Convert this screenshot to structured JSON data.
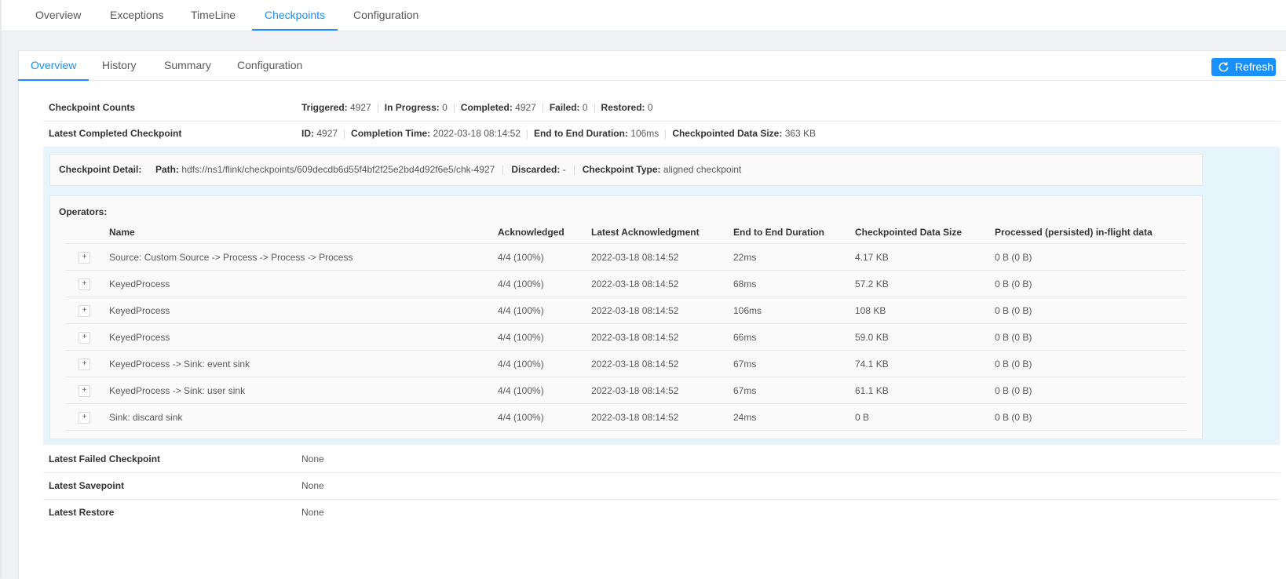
{
  "top_tabs": [
    {
      "label": "Overview"
    },
    {
      "label": "Exceptions"
    },
    {
      "label": "TimeLine"
    },
    {
      "label": "Checkpoints"
    },
    {
      "label": "Configuration"
    }
  ],
  "sub_tabs": [
    {
      "label": "Overview"
    },
    {
      "label": "History"
    },
    {
      "label": "Summary"
    },
    {
      "label": "Configuration"
    }
  ],
  "refresh": {
    "label": "Refresh",
    "icon": "refresh-icon"
  },
  "counts": {
    "label": "Checkpoint Counts",
    "triggered_k": "Triggered:",
    "triggered_v": "4927",
    "in_progress_k": "In Progress:",
    "in_progress_v": "0",
    "completed_k": "Completed:",
    "completed_v": "4927",
    "failed_k": "Failed:",
    "failed_v": "0",
    "restored_k": "Restored:",
    "restored_v": "0"
  },
  "latest_completed": {
    "label": "Latest Completed Checkpoint",
    "id_k": "ID:",
    "id_v": "4927",
    "time_k": "Completion Time:",
    "time_v": "2022-03-18 08:14:52",
    "duration_k": "End to End Duration:",
    "duration_v": "106ms",
    "size_k": "Checkpointed Data Size:",
    "size_v": "363 KB"
  },
  "detail": {
    "label": "Checkpoint Detail:",
    "path_k": "Path:",
    "path_v": "hdfs://ns1/flink/checkpoints/609decdb6d55f4bf2f25e2bd4d92f6e5/chk-4927",
    "discarded_k": "Discarded:",
    "discarded_v": "-",
    "type_k": "Checkpoint Type:",
    "type_v": "aligned checkpoint"
  },
  "operators": {
    "title": "Operators:",
    "columns": [
      "Name",
      "Acknowledged",
      "Latest Acknowledgment",
      "End to End Duration",
      "Checkpointed Data Size",
      "Processed (persisted) in-flight data"
    ],
    "rows": [
      {
        "name": "Source: Custom Source -> Process -> Process -> Process",
        "ack": "4/4 (100%)",
        "latest": "2022-03-18 08:14:52",
        "duration": "22ms",
        "size": "4.17 KB",
        "processed": "0 B (0 B)"
      },
      {
        "name": "KeyedProcess",
        "ack": "4/4 (100%)",
        "latest": "2022-03-18 08:14:52",
        "duration": "68ms",
        "size": "57.2 KB",
        "processed": "0 B (0 B)"
      },
      {
        "name": "KeyedProcess",
        "ack": "4/4 (100%)",
        "latest": "2022-03-18 08:14:52",
        "duration": "106ms",
        "size": "108 KB",
        "processed": "0 B (0 B)"
      },
      {
        "name": "KeyedProcess",
        "ack": "4/4 (100%)",
        "latest": "2022-03-18 08:14:52",
        "duration": "66ms",
        "size": "59.0 KB",
        "processed": "0 B (0 B)"
      },
      {
        "name": "KeyedProcess -> Sink: event sink",
        "ack": "4/4 (100%)",
        "latest": "2022-03-18 08:14:52",
        "duration": "67ms",
        "size": "74.1 KB",
        "processed": "0 B (0 B)"
      },
      {
        "name": "KeyedProcess -> Sink: user sink",
        "ack": "4/4 (100%)",
        "latest": "2022-03-18 08:14:52",
        "duration": "67ms",
        "size": "61.1 KB",
        "processed": "0 B (0 B)"
      },
      {
        "name": "Sink: discard sink",
        "ack": "4/4 (100%)",
        "latest": "2022-03-18 08:14:52",
        "duration": "24ms",
        "size": "0 B",
        "processed": "0 B (0 B)"
      }
    ],
    "expand_symbol": "+"
  },
  "latest_failed": {
    "label": "Latest Failed Checkpoint",
    "value": "None"
  },
  "latest_savepoint": {
    "label": "Latest Savepoint",
    "value": "None"
  },
  "latest_restore": {
    "label": "Latest Restore",
    "value": "None"
  },
  "colors": {
    "accent": "#1890ff",
    "highlight": "#e6f4fc"
  }
}
